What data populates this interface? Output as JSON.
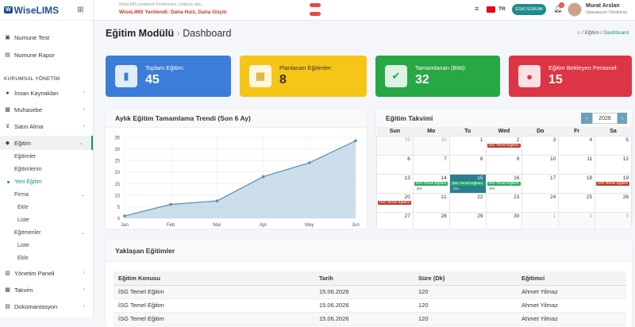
{
  "app": {
    "logo_box": "W",
    "logo_text": "WiseLIMS"
  },
  "sidebar": {
    "top_items": [
      {
        "label": "Numune Test",
        "icon": "flask-icon"
      },
      {
        "label": "Numune Rapor",
        "icon": "report-icon"
      }
    ],
    "section_title": "KURUMSAL YÖNETİM",
    "items": [
      {
        "label": "İnsan Kaynakları",
        "icon": "people-icon"
      },
      {
        "label": "Muhasebe",
        "icon": "calculator-icon"
      },
      {
        "label": "Satın Alma",
        "icon": "cart-icon"
      },
      {
        "label": "Eğitim",
        "icon": "graduation-icon"
      }
    ],
    "egitim_sub": [
      "Eğitimler",
      "Eğitimlerim",
      "Yeni Eğitim",
      "Firma",
      "Ekle",
      "Liste",
      "Eğitmenler",
      "Liste",
      "Ekle"
    ],
    "bottom_items": [
      {
        "label": "Yönetim Paneli",
        "icon": "dashboard-icon"
      },
      {
        "label": "Takvim",
        "icon": "calendar-icon"
      },
      {
        "label": "Dokümantasyon",
        "icon": "document-icon"
      }
    ]
  },
  "topbar": {
    "news_line1": "WiseLIMS yenilendi! Performans, kullanıcı dan...",
    "news_line2": "WiseLIMS Yenilendi: Daha Hızlı, Daha Güçlü",
    "lang": "TR",
    "button_label": "ESKİ SÜRÜM",
    "notif_count": "4",
    "user_name": "Murat Arslan",
    "user_role": "Operasyon Yöneticisi"
  },
  "page": {
    "module": "Eğitim Modülü",
    "sep": "›",
    "title": "Dashboard",
    "breadcrumb": [
      "Eğitim",
      "Dashboard"
    ]
  },
  "stats": [
    {
      "label": "Toplam Eğitim:",
      "value": "45",
      "color": "#3b7dd8",
      "icon": "book-icon"
    },
    {
      "label": "Planlanan Eğitimler:",
      "value": "8",
      "color": "#f5c518",
      "icon": "calendar-icon"
    },
    {
      "label": "Tamamlanan (Bitti):",
      "value": "32",
      "color": "#28a745",
      "icon": "check-icon"
    },
    {
      "label": "Eğitim Bekleyen Personel:",
      "value": "15",
      "color": "#dc3545",
      "icon": "user-clock-icon"
    }
  ],
  "chart_panel": {
    "title": "Aylık Eğitim Tamamlama Trendi (Son 6 Ay)"
  },
  "chart_data": {
    "type": "area",
    "categories": [
      "Jan",
      "Feb",
      "Mar",
      "Apr",
      "May",
      "Jun"
    ],
    "series": [
      {
        "values": [
          1,
          6,
          7.5,
          18,
          24,
          33.5
        ]
      }
    ],
    "ylim": [
      0,
      35
    ],
    "yticks": [
      0,
      5,
      10,
      15,
      20,
      25,
      30,
      35
    ],
    "grid": true,
    "colors": {
      "line": "#5a8db0",
      "fill": "#b9d3e3"
    }
  },
  "calendar": {
    "title": "Eğitim Takvimi",
    "year": "2026",
    "prev": "‹",
    "next": "›",
    "days": [
      "Sun",
      "Mo",
      "Tu",
      "Wed",
      "Do",
      "Fr",
      "Sa"
    ],
    "weeks": [
      [
        "29",
        "30",
        "1",
        "2",
        "3",
        "4",
        "5"
      ],
      [
        "6",
        "7",
        "8",
        "9",
        "10",
        "11",
        "12"
      ],
      [
        "13",
        "14",
        "15",
        "16",
        "17",
        "18",
        "19"
      ],
      [
        "20",
        "21",
        "22",
        "23",
        "24",
        "25",
        "26"
      ],
      [
        "27",
        "28",
        "29",
        "30",
        "1",
        "2",
        "3"
      ]
    ],
    "event_label": "İSG Temel Eğitimi",
    "event_pcts": {
      "14": "2%",
      "15": "1%",
      "16": "2%"
    }
  },
  "upcoming": {
    "title": "Yaklaşan Eğitimler",
    "headers": [
      "Eğitim Konusu",
      "Tarih",
      "Süre (Dk)",
      "Eğitimci"
    ],
    "rows": [
      [
        "İSG Temel Eğitim",
        "15.06.2026",
        "120",
        "Ahmet Yilmaz"
      ],
      [
        "İSG Temel Eğitim",
        "15.06.2026",
        "120",
        "Ahmet Yilmaz"
      ],
      [
        "İSG Temel Eğitim",
        "15.06.2026",
        "120",
        "Ahmet Yilmaz"
      ]
    ]
  }
}
